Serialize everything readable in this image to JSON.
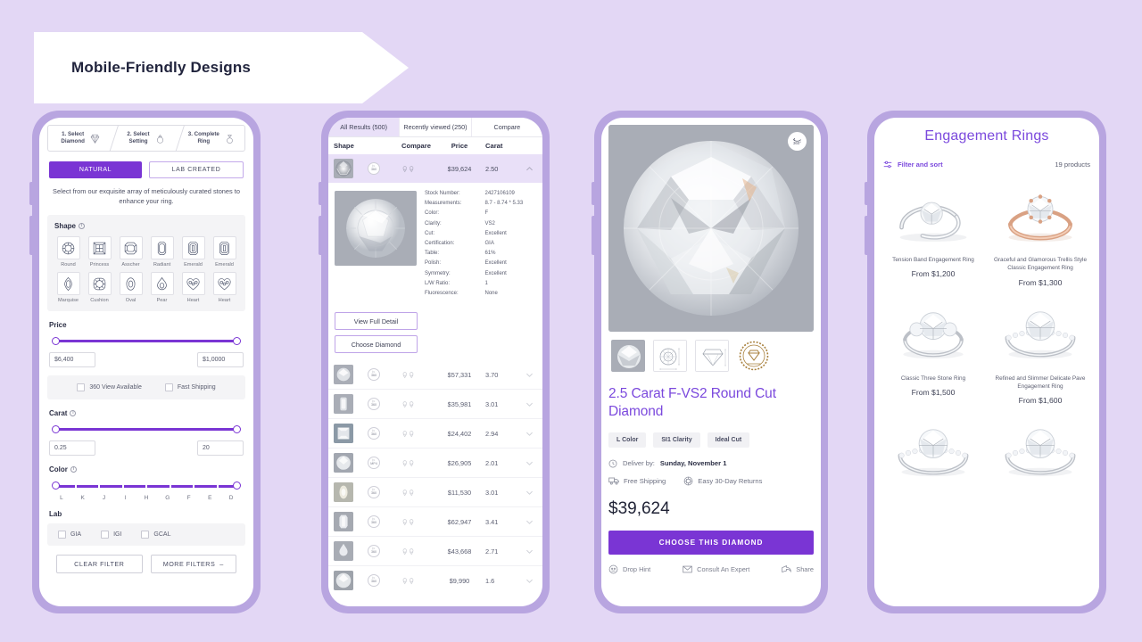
{
  "banner": {
    "title": "Mobile-Friendly Designs"
  },
  "phone1": {
    "steps": [
      {
        "num": "1.",
        "label": "Select\nDiamond",
        "icon": "diamond-icon"
      },
      {
        "num": "2.",
        "label": "Select\nSetting",
        "icon": "ring-icon"
      },
      {
        "num": "3.",
        "label": "Complete\nRing",
        "icon": "complete-ring-icon"
      }
    ],
    "segments": [
      {
        "label": "NATURAL",
        "active": true
      },
      {
        "label": "LAB CREATED",
        "active": false
      }
    ],
    "lede": "Select from our exquisite array of meticulously curated stones to enhance your ring.",
    "shape": {
      "title": "Shape",
      "items": [
        "Round",
        "Princess",
        "Asscher",
        "Radiant",
        "Emerald",
        "Emerald",
        "Marquise",
        "Cushion",
        "Oval",
        "Pear",
        "Heart",
        "Heart"
      ]
    },
    "price": {
      "title": "Price",
      "min": "$6,400",
      "max": "$1,0000"
    },
    "checkboxes": [
      {
        "label": "360 View Available",
        "checked": false
      },
      {
        "label": "Fast Shipping",
        "checked": false
      }
    ],
    "carat": {
      "title": "Carat",
      "min": "0.25",
      "max": "20"
    },
    "color": {
      "title": "Color",
      "scale": [
        "L",
        "K",
        "J",
        "I",
        "H",
        "G",
        "F",
        "E",
        "D"
      ]
    },
    "lab": {
      "title": "Lab",
      "options": [
        {
          "label": "GIA",
          "checked": false
        },
        {
          "label": "IGI",
          "checked": false
        },
        {
          "label": "GCAL",
          "checked": false
        }
      ]
    },
    "buttons": {
      "clear": "CLEAR FILTER",
      "more": "MORE FILTERS"
    }
  },
  "phone2": {
    "tabs": [
      {
        "label": "All Results (500)",
        "active": true
      },
      {
        "label": "Recently viewed (250)",
        "active": false
      },
      {
        "label": "Compare",
        "active": false
      }
    ],
    "columns": [
      "Shape",
      "Compare",
      "Price",
      "Carat"
    ],
    "selected_row": {
      "price": "$39,624",
      "carat": "2.50"
    },
    "specs": [
      {
        "key": "Stock Number:",
        "value": "2427106109"
      },
      {
        "key": "Measurements:",
        "value": "8.7 - 8.74 * 5.33"
      },
      {
        "key": "Color:",
        "value": "F"
      },
      {
        "key": "Clarity:",
        "value": "VS2"
      },
      {
        "key": "Cut:",
        "value": "Excellent"
      },
      {
        "key": "Certification:",
        "value": "GIA"
      },
      {
        "key": "Table:",
        "value": "61%"
      },
      {
        "key": "Polish:",
        "value": "Excellent"
      },
      {
        "key": "Symmetry:",
        "value": "Excellent"
      },
      {
        "key": "L/W Ratio:",
        "value": "1"
      },
      {
        "key": "Fluorescence:",
        "value": "None"
      }
    ],
    "detail_buttons": {
      "view": "View Full Detail",
      "choose": "Choose Diamond"
    },
    "rows": [
      {
        "price": "$57,331",
        "carat": "3.70"
      },
      {
        "price": "$35,981",
        "carat": "3.01"
      },
      {
        "price": "$24,402",
        "carat": "2.94"
      },
      {
        "price": "$26,905",
        "carat": "2.01"
      },
      {
        "price": "$11,530",
        "carat": "3.01"
      },
      {
        "price": "$62,947",
        "carat": "3.41"
      },
      {
        "price": "$43,668",
        "carat": "2.71"
      },
      {
        "price": "$9,990",
        "carat": "1.6"
      }
    ]
  },
  "phone3": {
    "badge_360": "360°",
    "title": "2.5 Carat F-VS2 Round Cut Diamond",
    "chips": [
      "L Color",
      "SI1 Clarity",
      "Ideal Cut"
    ],
    "delivery_label": "Deliver by:",
    "delivery_date": "Sunday, November 1",
    "shipping": "Free Shipping",
    "returns": "Easy 30-Day Returns",
    "price": "$39,624",
    "cta": "CHOOSE THIS DIAMOND",
    "actions": [
      "Drop Hint",
      "Consult An Expert",
      "Share"
    ]
  },
  "phone4": {
    "title": "Engagement Rings",
    "filter_label": "Filter and sort",
    "count": "19 products",
    "products": [
      {
        "name": "Tension Band Engagement Ring",
        "price": "From $1,200",
        "metal": "white"
      },
      {
        "name": "Graceful and Glamorous Trellis Style Classic Engagement Ring",
        "price": "From $1,300",
        "metal": "rose"
      },
      {
        "name": "Classic Three Stone Ring",
        "price": "From $1,500",
        "metal": "white"
      },
      {
        "name": "Refined and Slimmer Delicate Pave Engagement Ring",
        "price": "From $1,600",
        "metal": "white"
      },
      {
        "name": "",
        "price": "",
        "metal": "white"
      },
      {
        "name": "",
        "price": "",
        "metal": "white"
      }
    ]
  },
  "colors": {
    "background": "#e3d7f5",
    "phone_frame": "#b8a5e0",
    "accent": "#7a35d4",
    "accent_text": "#7b49dd",
    "row_highlight": "#e9e0f8"
  }
}
